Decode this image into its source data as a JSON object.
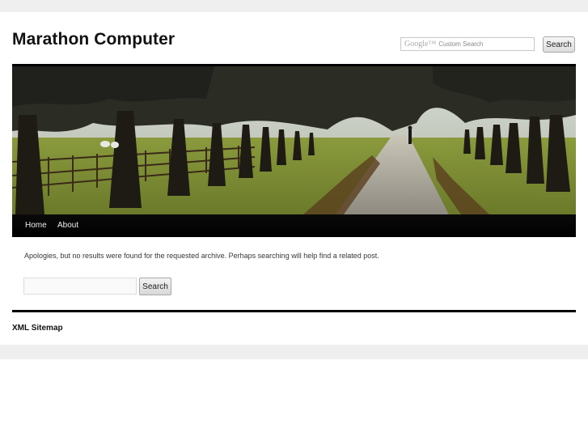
{
  "site": {
    "title": "Marathon Computer"
  },
  "header_search": {
    "logo_text": "Google™",
    "placeholder": "Custom Search",
    "button_label": "Search"
  },
  "nav": {
    "items": [
      {
        "label": "Home"
      },
      {
        "label": "About"
      }
    ]
  },
  "content": {
    "message": "Apologies, but no results were found for the requested archive. Perhaps searching will help find a related post.",
    "search_button_label": "Search",
    "search_value": ""
  },
  "footer": {
    "sitemap_link": "XML Sitemap"
  }
}
